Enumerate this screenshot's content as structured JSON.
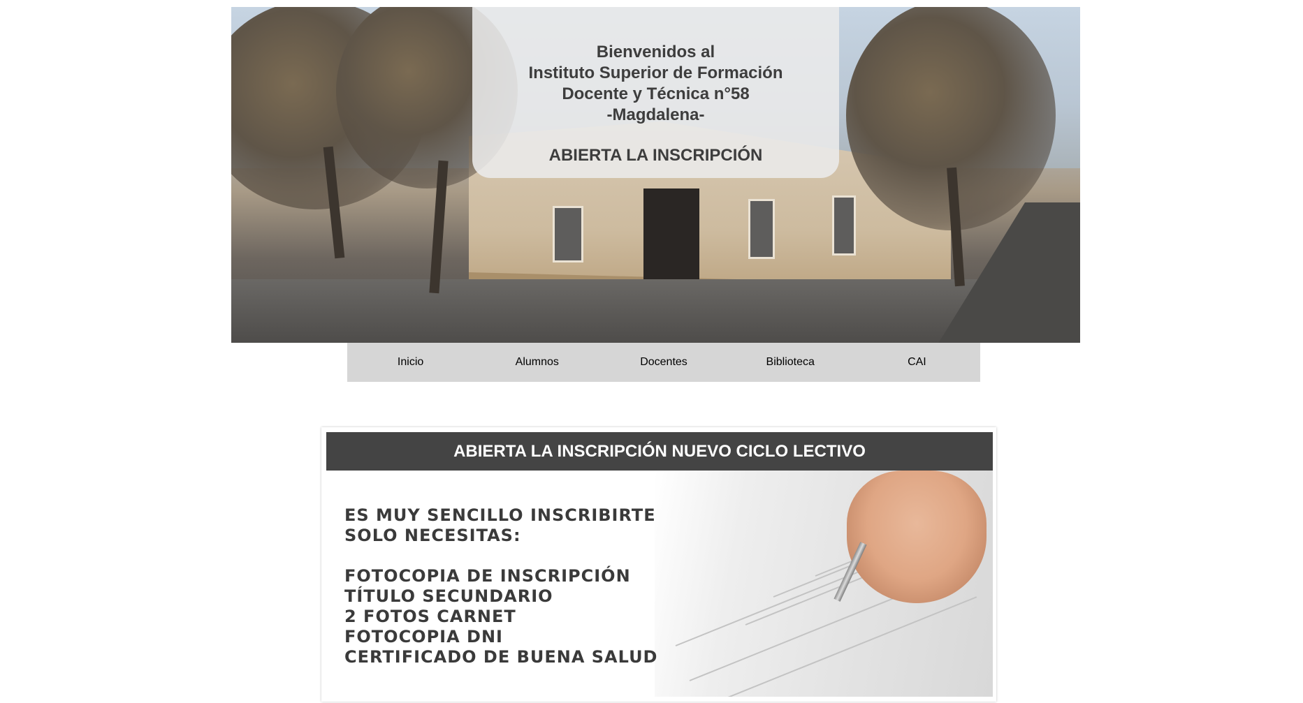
{
  "hero": {
    "welcome_lines": [
      "Bienvenidos al",
      "Instituto Superior de Formación",
      "Docente y Técnica n°58",
      "-Magdalena-"
    ],
    "open_label": "ABIERTA LA INSCRIPCIÓN"
  },
  "nav": {
    "items": [
      "Inicio",
      "Alumnos",
      "Docentes",
      "Biblioteca",
      "CAI"
    ]
  },
  "inscription": {
    "header": "ABIERTA LA INSCRIPCIÓN NUEVO CICLO LECTIVO",
    "intro_lines": [
      "ES MUY SENCILLO INSCRIBIRTE",
      "SOLO NECESITAS:"
    ],
    "requirements": [
      "FOTOCOPIA DE INSCRIPCIÓN",
      "TÍTULO SECUNDARIO",
      "2 FOTOS CARNET",
      "FOTOCOPIA DNI",
      "CERTIFICADO DE BUENA SALUD"
    ]
  }
}
